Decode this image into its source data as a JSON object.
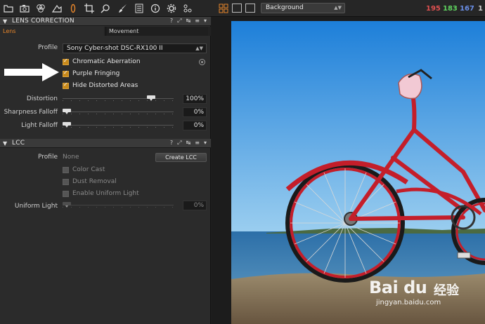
{
  "toolbar": {
    "background_select": "Background",
    "rgb": {
      "r": "195",
      "g": "183",
      "b": "167",
      "extra": "1"
    },
    "colors": {
      "r": "#e05050",
      "g": "#5fd35f",
      "b": "#6a8fe8",
      "accent": "#e8862b"
    }
  },
  "lens_correction": {
    "title": "LENS CORRECTION",
    "tabs": [
      "Lens",
      "Movement"
    ],
    "profile_label": "Profile",
    "profile_value": "Sony Cyber-shot DSC-RX100 II",
    "checks": [
      {
        "label": "Chromatic Aberration",
        "checked": true
      },
      {
        "label": "Purple Fringing",
        "checked": true
      },
      {
        "label": "Hide Distorted Areas",
        "checked": true
      }
    ],
    "sliders": [
      {
        "label": "Distortion",
        "value": "100%",
        "level": 1.0
      },
      {
        "label": "Sharpness Falloff",
        "value": "0%",
        "level": 0.0
      },
      {
        "label": "Light Falloff",
        "value": "0%",
        "level": 0.0
      }
    ]
  },
  "lcc": {
    "title": "LCC",
    "profile_label": "Profile",
    "profile_value": "None",
    "create_button": "Create LCC",
    "checks": [
      {
        "label": "Color Cast",
        "checked": false
      },
      {
        "label": "Dust Removal",
        "checked": false
      },
      {
        "label": "Enable Uniform Light",
        "checked": false
      }
    ],
    "uniform_light_label": "Uniform Light",
    "uniform_light_value": "0%"
  },
  "header_icons": [
    "?",
    "⤢",
    "↹",
    "≡",
    "▾"
  ],
  "watermark": {
    "logo": "Bai du",
    "cn": "经验",
    "url": "jingyan.baidu.com"
  }
}
